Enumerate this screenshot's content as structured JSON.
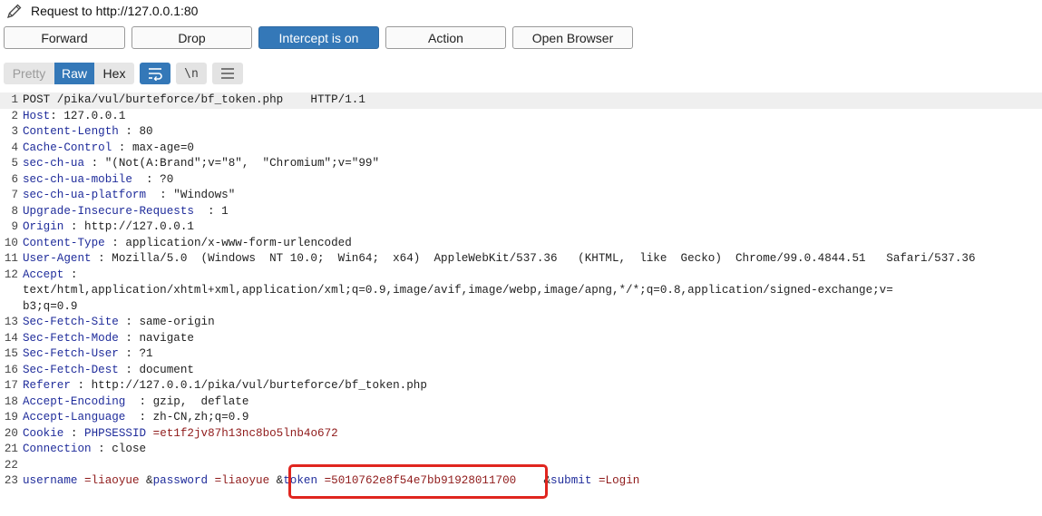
{
  "header": {
    "title": "Request to http://127.0.0.1:80",
    "icon": "pencil-icon"
  },
  "toolbar": {
    "forward": "Forward",
    "drop": "Drop",
    "intercept": "Intercept is on",
    "action": "Action",
    "open_browser": "Open Browser"
  },
  "viewbar": {
    "pretty": "Pretty",
    "raw": "Raw",
    "hex": "Hex",
    "newline": "\\n"
  },
  "request": {
    "l1": "POST /pika/vul/burteforce/bf_token.php    HTTP/1.1",
    "h2_k": "Host",
    "h2_v": "127.0.0.1",
    "h3_k": "Content-Length",
    "h3_v": "80",
    "h4_k": "Cache-Control",
    "h4_v": "max-age=0",
    "h5_k": "sec-ch-ua",
    "h5_v": "\"(Not(A:Brand\";v=\"8\",  \"Chromium\";v=\"99\"",
    "h6_k": "sec-ch-ua-mobile",
    "h6_v": "?0",
    "h7_k": "sec-ch-ua-platform",
    "h7_v": "\"Windows\"",
    "h8_k": "Upgrade-Insecure-Requests",
    "h8_v": "1",
    "h9_k": "Origin",
    "h9_v": "http://127.0.0.1",
    "h10_k": "Content-Type",
    "h10_v": "application/x-www-form-urlencoded",
    "h11_k": "User-Agent",
    "h11_v": "Mozilla/5.0  (Windows  NT 10.0;  Win64;  x64)  AppleWebKit/537.36   (KHTML,  like  Gecko)  Chrome/99.0.4844.51   Safari/537.36",
    "h12_k": "Accept",
    "h12_v1": "text/html,application/xhtml+xml,application/xml;q=0.9,image/avif,image/webp,image/apng,*/*;q=0.8,application/signed-exchange;v=",
    "h12_v2": "b3;q=0.9",
    "h13_k": "Sec-Fetch-Site",
    "h13_v": "same-origin",
    "h14_k": "Sec-Fetch-Mode",
    "h14_v": "navigate",
    "h15_k": "Sec-Fetch-User",
    "h15_v": "?1",
    "h16_k": "Sec-Fetch-Dest",
    "h16_v": "document",
    "h17_k": "Referer",
    "h17_v": "http://127.0.0.1/pika/vul/burteforce/bf_token.php",
    "h18_k": "Accept-Encoding",
    "h18_v": "gzip,  deflate",
    "h19_k": "Accept-Language",
    "h19_v": "zh-CN,zh;q=0.9",
    "h20_k": "Cookie",
    "h20_ck": "PHPSESSID",
    "h20_cv": "et1f2jv87h13nc8bo5lnb4o672",
    "h21_k": "Connection",
    "h21_v": "close",
    "body": {
      "username_k": "username",
      "username_v": "liaoyue",
      "password_k": "password",
      "password_v": "liaoyue",
      "token_k": "token",
      "token_v": "5010762e8f54e7bb91928011700",
      "submit_k": "submit",
      "submit_v": "Login"
    }
  },
  "line_numbers": [
    "1",
    "2",
    "3",
    "4",
    "5",
    "6",
    "7",
    "8",
    "9",
    "10",
    "11",
    "12",
    "13",
    "14",
    "15",
    "16",
    "17",
    "18",
    "19",
    "20",
    "21",
    "22",
    "23"
  ]
}
